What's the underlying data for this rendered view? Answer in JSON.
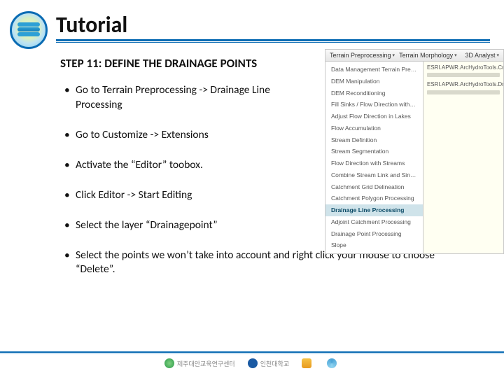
{
  "header": {
    "title": "Tutorial"
  },
  "step": {
    "title": "STEP 11: DEFINE THE DRAINAGE POINTS"
  },
  "bullets": [
    "Go to Terrain Preprocessing -> Drainage Line Processing",
    "Go to Customize -> Extensions",
    "Activate the “Editor” toobox.",
    "Click Editor -> Start Editing",
    "Select the layer “Drainagepoint”",
    "Select the points we won’t take into account and right click your mouse to choose “Delete”."
  ],
  "screenshot": {
    "toolbar": {
      "left": "Terrain Preprocessing",
      "mid": "Terrain Morphology",
      "right": "3D Analyst"
    },
    "menu": [
      "Data Management Terrain Preprocessing",
      "DEM Manipulation",
      "DEM Reconditioning",
      "Fill Sinks / Flow Direction with Sinks",
      "Adjust Flow Direction in Lakes",
      "Flow Accumulation",
      "Stream Definition",
      "Stream Segmentation",
      "Flow Direction with Streams",
      "Combine Stream Link and Sink Link",
      "Catchment Grid Delineation",
      "Catchment Polygon Processing",
      "Drainage Line Processing",
      "Adjoint Catchment Processing",
      "Drainage Point Processing",
      "Slope"
    ],
    "menu_highlight_index": 12,
    "info": [
      "ESRI.APWR.ArcHydroTools.CmdDrainageLineProcessing",
      "ESRI.APWR.ArcHydroTools.DrainageLineProcessing"
    ]
  },
  "footer": {
    "logos": [
      "제주대안교육연구센터",
      "인천대학교",
      "",
      ""
    ]
  }
}
